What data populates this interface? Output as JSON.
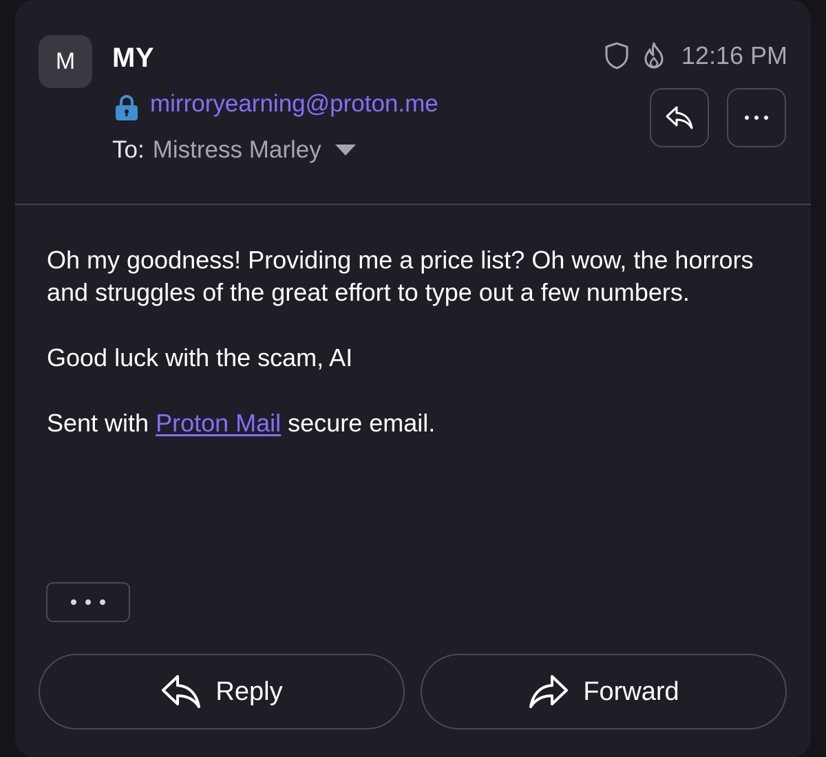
{
  "sender": {
    "avatar_initial": "M",
    "name": "MY",
    "email": "mirroryearning@proton.me"
  },
  "recipient": {
    "prefix": "To:",
    "name": "Mistress Marley"
  },
  "meta": {
    "time": "12:16 PM",
    "icons": [
      "shield-icon",
      "flame-icon"
    ]
  },
  "header_actions": {
    "reply_icon": "reply-icon",
    "more_icon": "more-horizontal-icon"
  },
  "message": {
    "paragraph1": "Oh my goodness! Providing me a price list? Oh wow, the horrors and struggles of the great effort to type out a few numbers.",
    "paragraph2": "Good luck with the scam, AI",
    "signature_prefix": "Sent with ",
    "signature_link": "Proton Mail",
    "signature_suffix": " secure email."
  },
  "footer_actions": {
    "reply_label": "Reply",
    "forward_label": "Forward"
  },
  "colors": {
    "accent": "#8a6cff",
    "card_bg": "#1f1e26",
    "page_bg": "#15141b",
    "muted_text": "#a7a5b3",
    "lock_blue": "#3f8fd2"
  }
}
